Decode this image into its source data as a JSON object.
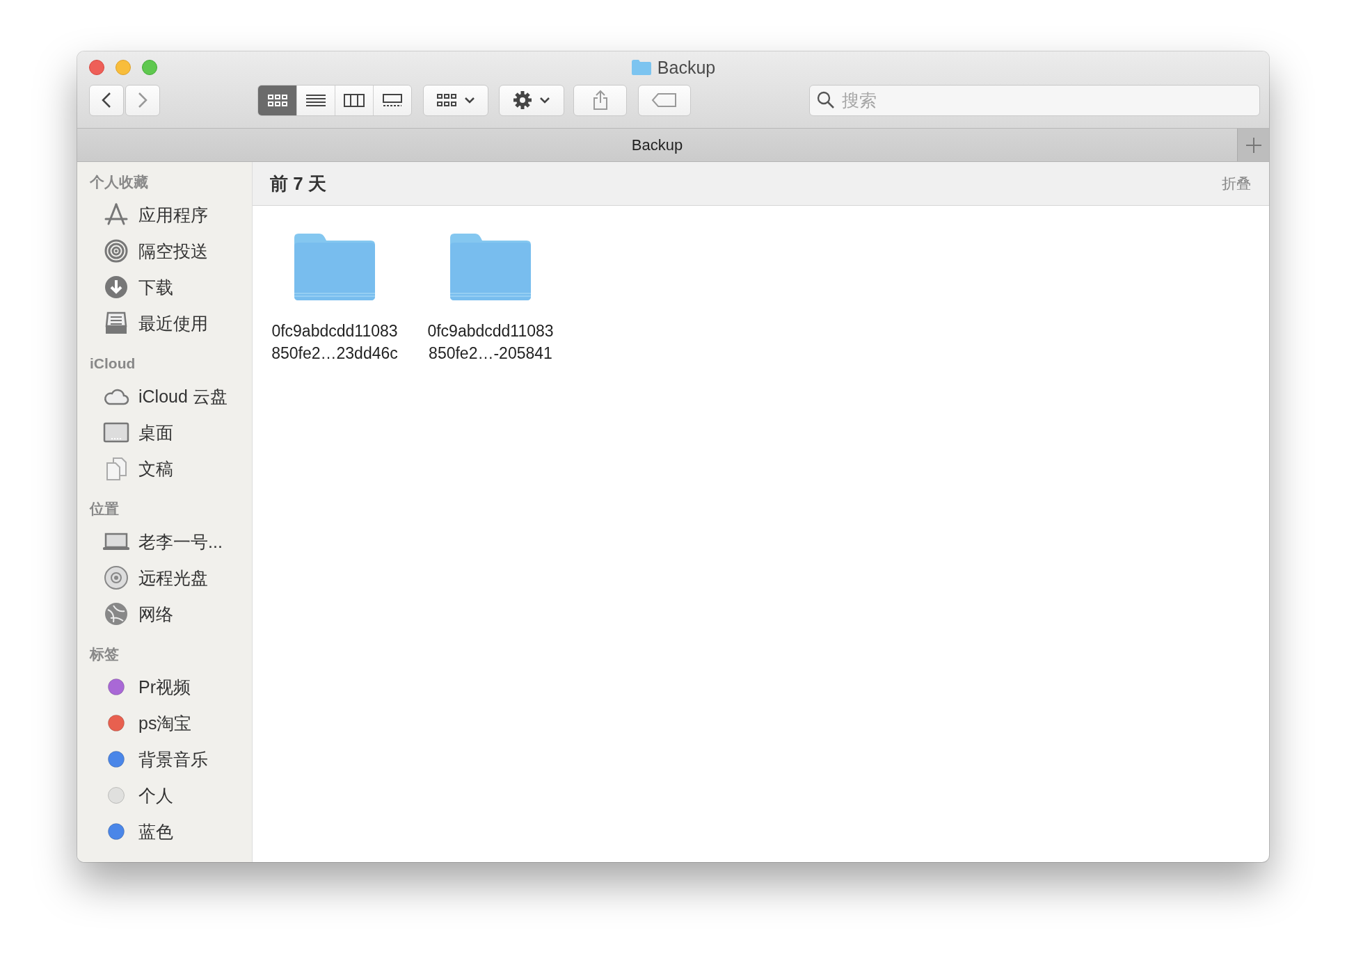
{
  "window": {
    "title": "Backup"
  },
  "toolbar": {
    "view_modes": [
      {
        "selected": true
      },
      {
        "selected": false
      },
      {
        "selected": false
      },
      {
        "selected": false
      }
    ],
    "search": {
      "placeholder": "搜索"
    }
  },
  "tab_bar": {
    "title": "Backup"
  },
  "sidebar": {
    "sections": [
      {
        "title": "个人收藏",
        "items": [
          {
            "kind": "apps",
            "label": "应用程序"
          },
          {
            "kind": "airdrop",
            "label": "隔空投送"
          },
          {
            "kind": "download",
            "label": "下载"
          },
          {
            "kind": "recent",
            "label": "最近使用"
          }
        ]
      },
      {
        "title": "iCloud",
        "items": [
          {
            "kind": "cloud",
            "label": "iCloud 云盘"
          },
          {
            "kind": "desktop",
            "label": "桌面"
          },
          {
            "kind": "document",
            "label": "文稿"
          }
        ]
      },
      {
        "title": "位置",
        "items": [
          {
            "kind": "laptop",
            "label": "老李一号..."
          },
          {
            "kind": "disc",
            "label": "远程光盘"
          },
          {
            "kind": "network",
            "label": "网络"
          }
        ]
      },
      {
        "title": "标签",
        "items": [
          {
            "kind": "tag",
            "label": "Pr视频",
            "color": "#a968d6"
          },
          {
            "kind": "tag",
            "label": "ps淘宝",
            "color": "#e8604f"
          },
          {
            "kind": "tag",
            "label": "背景音乐",
            "color": "#4a86e8"
          },
          {
            "kind": "tag",
            "label": "个人",
            "color": "#e0e0de"
          },
          {
            "kind": "tag",
            "label": "蓝色",
            "color": "#4a86e8"
          }
        ]
      }
    ]
  },
  "content": {
    "group_title": "前 7 天",
    "collapse_label": "折叠",
    "files": [
      {
        "name_lines": [
          "0fc9abdcdd11083",
          "850fe2…23dd46c"
        ]
      },
      {
        "name_lines": [
          "0fc9abdcdd11083",
          "850fe2…-205841"
        ]
      }
    ]
  }
}
